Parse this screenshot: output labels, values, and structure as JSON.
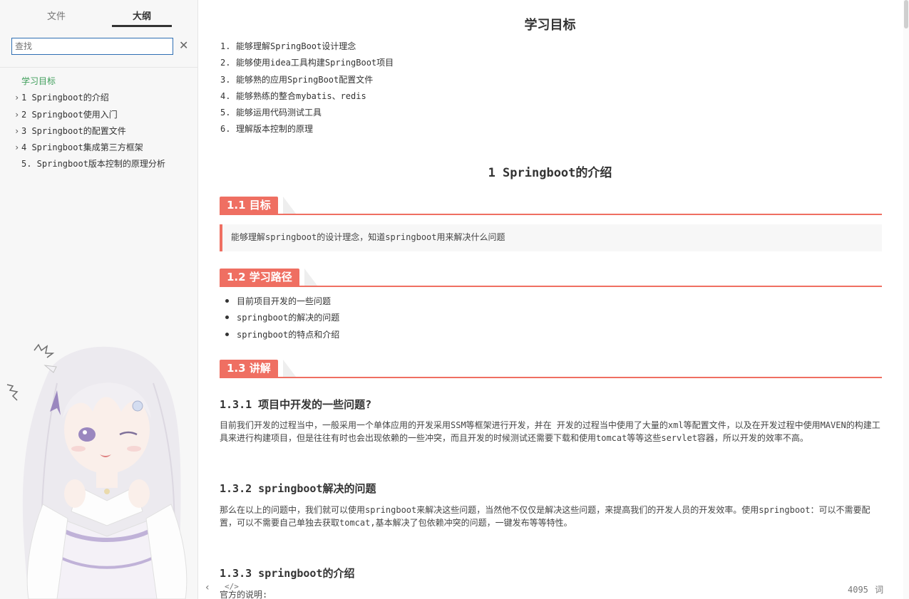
{
  "sidebar": {
    "tabs": [
      {
        "label": "文件"
      },
      {
        "label": "大纲"
      }
    ],
    "search": {
      "placeholder": "查找",
      "clear_icon": "close-icon"
    },
    "outline": [
      {
        "label": "学习目标",
        "active": true,
        "expandable": false
      },
      {
        "label": "1 Springboot的介绍",
        "expandable": true
      },
      {
        "label": "2 Springboot使用入门",
        "expandable": true
      },
      {
        "label": "3 Springboot的配置文件",
        "expandable": true
      },
      {
        "label": "4 Springboot集成第三方框架",
        "expandable": true
      },
      {
        "label": "5. Springboot版本控制的原理分析",
        "expandable": false
      }
    ]
  },
  "footer": {
    "back_icon": "chevron-left-icon",
    "code_icon": "source-code-icon",
    "word_count": "4095",
    "word_unit": "词"
  },
  "document": {
    "title": "学习目标",
    "goals": [
      {
        "num": "1.",
        "text": "能够理解SpringBoot设计理念"
      },
      {
        "num": "2.",
        "text": "能够使用idea工具构建SpringBoot项目"
      },
      {
        "num": "3.",
        "text": "能够熟的应用SpringBoot配置文件"
      },
      {
        "num": "4.",
        "text": "能够熟练的整合mybatis、redis"
      },
      {
        "num": "5.",
        "text": "能够运用代码测试工具"
      },
      {
        "num": "6.",
        "text": "理解版本控制的原理"
      }
    ],
    "section1_title": "1 Springboot的介绍",
    "s11": {
      "heading": "1.1 目标",
      "quote": "能够理解springboot的设计理念，知道springboot用来解决什么问题"
    },
    "s12": {
      "heading": "1.2 学习路径",
      "items": [
        "目前项目开发的一些问题",
        "springboot的解决的问题",
        "springboot的特点和介绍"
      ]
    },
    "s13": {
      "heading": "1.3 讲解"
    },
    "s131": {
      "heading": "1.3.1 项目中开发的一些问题?",
      "para": "目前我们开发的过程当中，一般采用一个单体应用的开发采用SSM等框架进行开发，并在 开发的过程当中使用了大量的xml等配置文件，以及在开发过程中使用MAVEN的构建工具来进行构建项目，但是往往有时也会出现依赖的一些冲突，而且开发的时候测试还需要下载和使用tomcat等等这些servlet容器，所以开发的效率不高。"
    },
    "s132": {
      "heading": "1.3.2 springboot解决的问题",
      "para": "那么在以上的问题中，我们就可以使用springboot来解决这些问题，当然他不仅仅是解决这些问题，来提高我们的开发人员的开发效率。使用springboot：可以不需要配置，可以不需要自己单独去获取tomcat,基本解决了包依赖冲突的问题，一键发布等等特性。"
    },
    "s133": {
      "heading": "1.3.3 springboot的介绍",
      "para_start": "官方的说明:"
    }
  },
  "colors": {
    "accent": "#ef6f62",
    "active_outline": "#3e9e5a",
    "search_border": "#2f6fb3"
  }
}
